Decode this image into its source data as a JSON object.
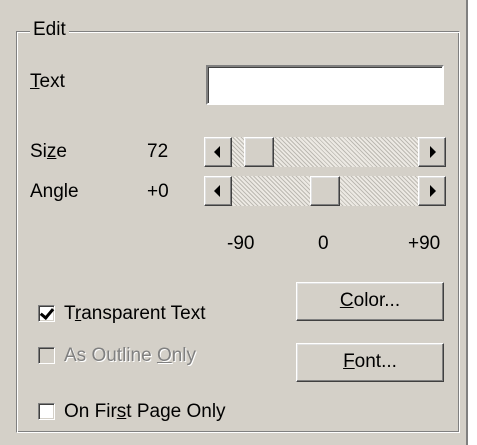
{
  "group": {
    "title": "Edit"
  },
  "text_field": {
    "label_pre": "",
    "label_mnemonic": "T",
    "label_post": "ext",
    "value": ""
  },
  "size": {
    "label_pre": "Si",
    "label_mnemonic": "z",
    "label_post": "e",
    "value": "72",
    "slider_fraction": 0.08
  },
  "angle": {
    "label": "Angle",
    "value": "+0",
    "slider_fraction": 0.5
  },
  "angle_ticks": [
    "-90",
    "0",
    "+90"
  ],
  "checkboxes": {
    "transparent": {
      "pre": "T",
      "mnemonic": "r",
      "post": "ansparent Text",
      "checked": true,
      "enabled": true
    },
    "outline": {
      "pre": "As Outline ",
      "mnemonic": "O",
      "post": "nly",
      "checked": false,
      "enabled": false
    },
    "first_page": {
      "pre": "On Fir",
      "mnemonic": "s",
      "post": "t Page Only",
      "checked": false,
      "enabled": true
    }
  },
  "buttons": {
    "color": {
      "pre": "",
      "mnemonic": "C",
      "post": "olor..."
    },
    "font": {
      "pre": "",
      "mnemonic": "F",
      "post": "ont..."
    }
  }
}
